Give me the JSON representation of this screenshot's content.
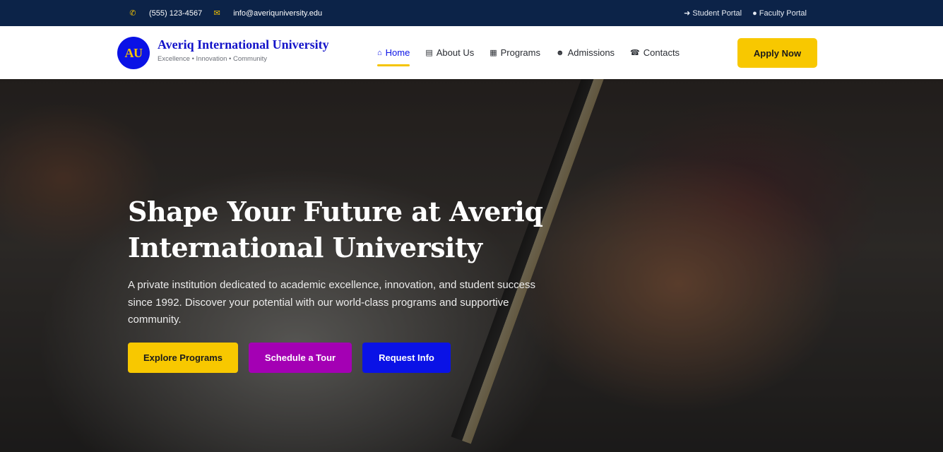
{
  "topbar": {
    "phone": "(555) 123-4567",
    "email": "info@averiquniversity.edu",
    "portals": [
      "Student Portal",
      "Faculty Portal"
    ]
  },
  "nav": {
    "logo_text": "AU",
    "brand_name": "Averiq International University",
    "tagline": "Excellence • Innovation • Community",
    "menu": [
      {
        "label": "Home",
        "icon": "home-icon",
        "active": true
      },
      {
        "label": "About Us",
        "icon": "book-icon",
        "active": false
      },
      {
        "label": "Programs",
        "icon": "boxes-icon",
        "active": false
      },
      {
        "label": "Admissions",
        "icon": "users-icon",
        "active": false
      },
      {
        "label": "Contacts",
        "icon": "phone-icon",
        "active": false
      }
    ],
    "apply_label": "Apply Now"
  },
  "hero": {
    "title_line1": "Shape Your Future at Averiq",
    "title_line2": "International University",
    "description": "A private institution dedicated to academic excellence, innovation, and student success since 1992. Discover your potential with our world-class programs and supportive community.",
    "buttons": [
      "Explore Programs",
      "Schedule a Tour",
      "Request Info"
    ]
  },
  "colors": {
    "topbar_bg": "#0c2348",
    "brand_blue": "#0a12e6",
    "accent_yellow": "#f8c800",
    "accent_purple": "#a400b4"
  }
}
